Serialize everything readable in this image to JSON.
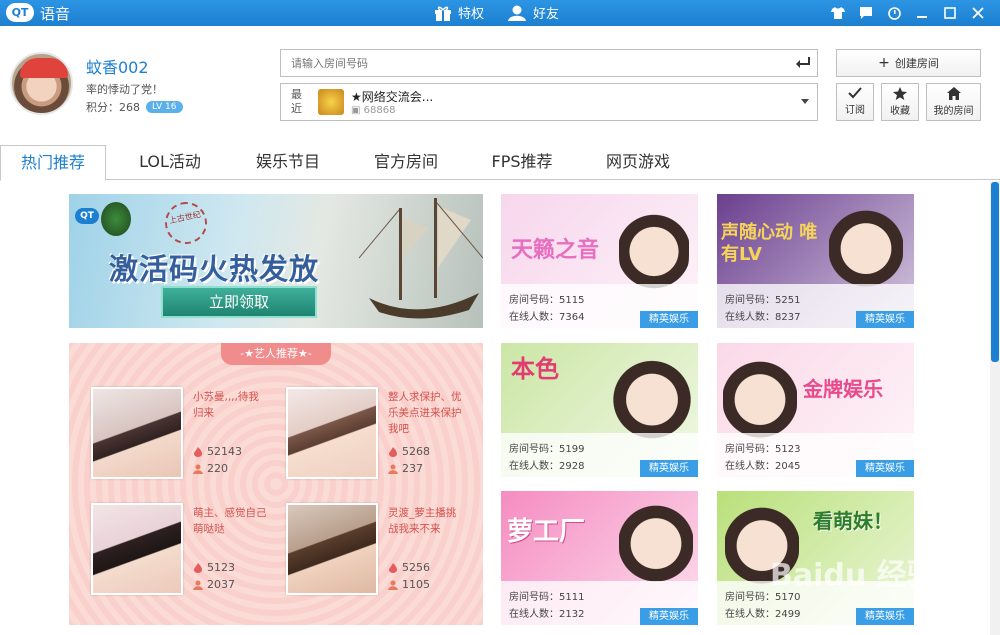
{
  "app": {
    "logo_text": "QT",
    "title": "语音",
    "nav": [
      {
        "label": "特权",
        "icon": "gift-icon"
      },
      {
        "label": "好友",
        "icon": "user-icon"
      }
    ],
    "window_controls": [
      "shirt-icon",
      "message-icon",
      "settings-icon",
      "minimize-icon",
      "maximize-icon",
      "close-icon"
    ]
  },
  "user": {
    "name": "蚊香002",
    "signature": "率的悸动了党！",
    "score_label": "积分：268",
    "level": "LV 16"
  },
  "search": {
    "placeholder": "请输入房间号码"
  },
  "recent": {
    "label": "最近",
    "room_name": "★网络交流会...",
    "room_id": "68868"
  },
  "actions": {
    "create_room": "创建房间",
    "subscribe": "订阅",
    "favorite": "收藏",
    "my_room": "我的房间"
  },
  "tabs": [
    "热门推荐",
    "LOL活动",
    "娱乐节目",
    "官方房间",
    "FPS推荐",
    "网页游戏"
  ],
  "banner": {
    "logo_text": "QT",
    "game_name": "上古世纪",
    "headline": "激活码火热发放",
    "button": "立即领取"
  },
  "artists": {
    "header": "-★艺人推荐★-",
    "items": [
      {
        "desc": "小苏曼,,,,待我归来",
        "likes": "52143",
        "fans": "220"
      },
      {
        "desc": "整人求保护、优乐美点进来保护我吧",
        "likes": "5268",
        "fans": "237"
      },
      {
        "desc": "萌主、感觉自己萌哒哒",
        "likes": "5123",
        "fans": "2037"
      },
      {
        "desc": "灵渡_萝主播挑战我来不来",
        "likes": "5256",
        "fans": "1105"
      }
    ]
  },
  "rooms": [
    {
      "title": "天籁之音",
      "room_no": "房间号码：5115",
      "online": "在线人数：7364",
      "badge": "精英娱乐",
      "bg": "#f7d6ec",
      "accent": "#e76fbf"
    },
    {
      "title": "声随心动 唯有LV",
      "room_no": "房间号码：5251",
      "online": "在线人数：8237",
      "badge": "精英娱乐",
      "bg": "#6b3f8f",
      "accent": "#f6d45a"
    },
    {
      "title": "本色",
      "room_no": "房间号码：5199",
      "online": "在线人数：2928",
      "badge": "精英娱乐",
      "bg": "#cbe6a5",
      "accent": "#e23c72"
    },
    {
      "title": "金牌娱乐",
      "room_no": "房间号码：5123",
      "online": "在线人数：2045",
      "badge": "精英娱乐",
      "bg": "#fbd9e8",
      "accent": "#e84a8c"
    },
    {
      "title": "萝工厂",
      "room_no": "房间号码：5111",
      "online": "在线人数：2132",
      "badge": "精英娱乐",
      "bg": "#f58cc1",
      "accent": "#ffffff"
    },
    {
      "title": "看萌妹！",
      "room_no": "房间号码：5170",
      "online": "在线人数：2499",
      "badge": "精英娱乐",
      "bg": "#b9e07a",
      "accent": "#2e7d2a"
    }
  ],
  "watermark": "Baidu 经验"
}
